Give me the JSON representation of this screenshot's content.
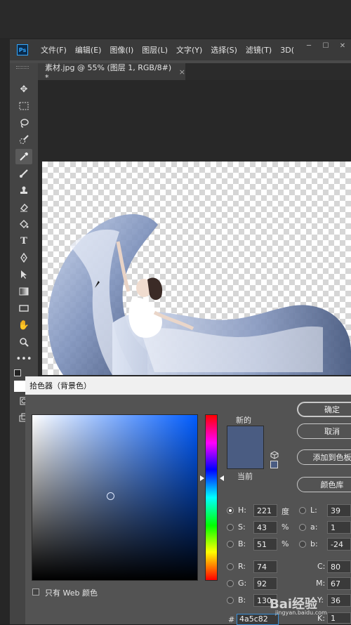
{
  "app": {
    "logo": "Ps"
  },
  "menu": [
    "文件(F)",
    "编辑(E)",
    "图像(I)",
    "图层(L)",
    "文字(Y)",
    "选择(S)",
    "滤镜(T)",
    "3D("
  ],
  "window_buttons": [
    "─",
    "☐",
    "✕"
  ],
  "document_tab": {
    "title": "素材.jpg @ 55% (图层 1, RGB/8#) *",
    "close": "×"
  },
  "tools": [
    "move-icon",
    "marquee-icon",
    "lasso-icon",
    "quick-select-icon",
    "eyedropper-icon",
    "brush-icon",
    "stamp-icon",
    "eraser-icon",
    "paint-bucket-icon",
    "type-icon",
    "pen-icon",
    "path-select-icon",
    "gradient-icon",
    "rectangle-icon",
    "hand-icon",
    "zoom-icon",
    "more-icon"
  ],
  "color_picker": {
    "title": "拾色器（背景色）",
    "new_label": "新的",
    "current_label": "当前",
    "new_color": "#4a5c82",
    "current_color": "#4a5c82",
    "buttons": {
      "ok": "确定",
      "cancel": "取消",
      "add_swatch": "添加到色板",
      "libraries": "颜色库"
    },
    "hsb": [
      {
        "label": "H:",
        "value": "221",
        "unit": "度",
        "selected": true
      },
      {
        "label": "S:",
        "value": "43",
        "unit": "%",
        "selected": false
      },
      {
        "label": "B:",
        "value": "51",
        "unit": "%",
        "selected": false
      }
    ],
    "rgb": [
      {
        "label": "R:",
        "value": "74"
      },
      {
        "label": "G:",
        "value": "92"
      },
      {
        "label": "B:",
        "value": "130"
      }
    ],
    "lab": [
      {
        "label": "L:",
        "value": "39"
      },
      {
        "label": "a:",
        "value": "1"
      },
      {
        "label": "b:",
        "value": "-24"
      }
    ],
    "cmyk": [
      {
        "label": "C:",
        "value": "80"
      },
      {
        "label": "M:",
        "value": "67"
      },
      {
        "label": "Y:",
        "value": "36"
      },
      {
        "label": "K:",
        "value": "1"
      }
    ],
    "web_only_label": "只有 Web 颜色",
    "hex_label": "#",
    "hex_value": "4a5c82"
  },
  "watermark": {
    "main": "Bai经验",
    "sub": "jingyan.baidu.com"
  }
}
